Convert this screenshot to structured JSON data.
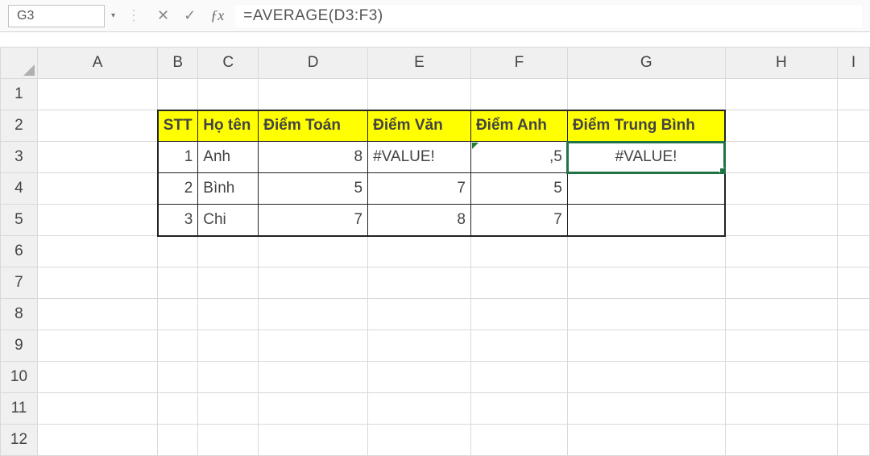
{
  "name_box": "G3",
  "formula": "=AVERAGE(D3:F3)",
  "icons": {
    "cancel": "✕",
    "confirm": "✓",
    "fx": "ƒx",
    "dots": "⋮",
    "dropdown": "▾",
    "warn": "!"
  },
  "columns": [
    "A",
    "B",
    "C",
    "D",
    "E",
    "F",
    "G",
    "H",
    "I"
  ],
  "rows": [
    "1",
    "2",
    "3",
    "4",
    "5",
    "6",
    "7",
    "8",
    "9",
    "10",
    "11",
    "12"
  ],
  "col_widths": {
    "rh": 46,
    "A": 150,
    "B": 50,
    "C": 75,
    "D": 136,
    "E": 128,
    "F": 120,
    "G": 196,
    "H": 140,
    "I": 40
  },
  "headers": {
    "B": "STT",
    "C": "Họ tên",
    "D": "Điểm Toán",
    "E": "Điểm Văn",
    "F": "Điểm Anh",
    "G": "Điểm Trung Bình"
  },
  "data": [
    {
      "stt": "1",
      "ten": "Anh",
      "toan": "8",
      "van": "#VALUE!",
      "anh": ",5",
      "tb": "#VALUE!"
    },
    {
      "stt": "2",
      "ten": "Bình",
      "toan": "5",
      "van": "7",
      "anh": "5",
      "tb": ""
    },
    {
      "stt": "3",
      "ten": "Chi",
      "toan": "7",
      "van": "8",
      "anh": "7",
      "tb": ""
    }
  ]
}
